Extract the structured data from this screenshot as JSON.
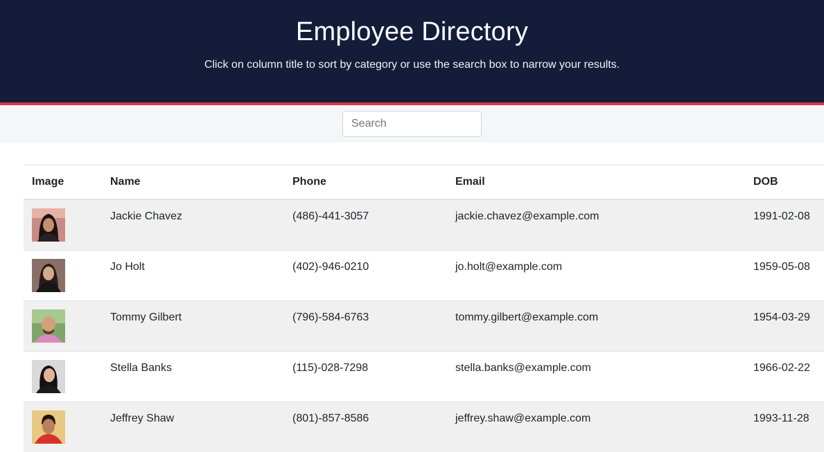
{
  "header": {
    "title": "Employee Directory",
    "subtitle": "Click on column title to sort by category or use the search box to narrow your results."
  },
  "search": {
    "placeholder": "Search",
    "value": ""
  },
  "table": {
    "columns": [
      "Image",
      "Name",
      "Phone",
      "Email",
      "DOB"
    ],
    "rows": [
      {
        "name": "Jackie Chavez",
        "phone": "(486)-441-3057",
        "email": "jackie.chavez@example.com",
        "dob": "1991-02-08"
      },
      {
        "name": "Jo Holt",
        "phone": "(402)-946-0210",
        "email": "jo.holt@example.com",
        "dob": "1959-05-08"
      },
      {
        "name": "Tommy Gilbert",
        "phone": "(796)-584-6763",
        "email": "tommy.gilbert@example.com",
        "dob": "1954-03-29"
      },
      {
        "name": "Stella Banks",
        "phone": "(115)-028-7298",
        "email": "stella.banks@example.com",
        "dob": "1966-02-22"
      },
      {
        "name": "Jeffrey Shaw",
        "phone": "(801)-857-8586",
        "email": "jeffrey.shaw@example.com",
        "dob": "1993-11-28"
      }
    ]
  },
  "colors": {
    "header_bg": "#141c3a",
    "header_border": "#dc3545",
    "stripe": "#f0f0f0"
  }
}
